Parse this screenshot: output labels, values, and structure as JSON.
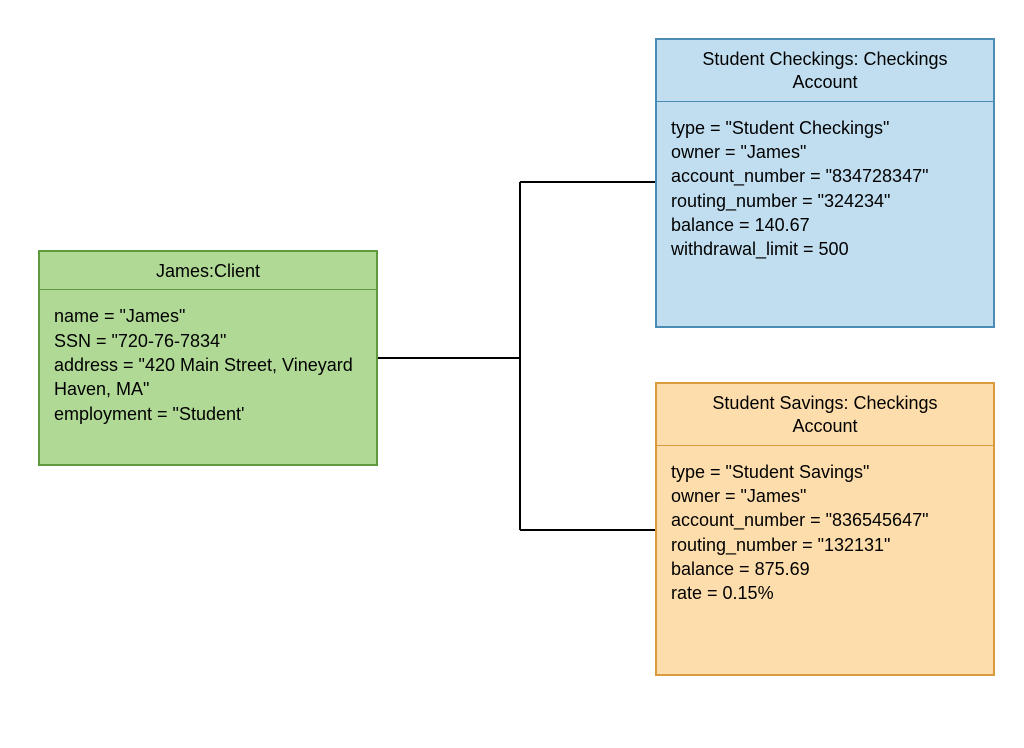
{
  "client": {
    "title": "James:Client",
    "body": "name = \"James\"\nSSN = \"720-76-7834\"\naddress = \"420 Main Street, Vineyard Haven, MA\"\nemployment = \"Student'"
  },
  "checkings": {
    "title": "Student Checkings: Checkings\nAccount",
    "body": "type = \"Student Checkings\"\nowner = \"James\"\naccount_number = \"834728347\"\nrouting_number = \"324234\"\nbalance = 140.67\nwithdrawal_limit = 500"
  },
  "savings": {
    "title": "Student Savings: Checkings\nAccount",
    "body": "type = \"Student Savings\"\nowner = \"James\"\naccount_number = \"836545647\"\nrouting_number = \"132131\"\nbalance = 875.69\nrate = 0.15%"
  }
}
